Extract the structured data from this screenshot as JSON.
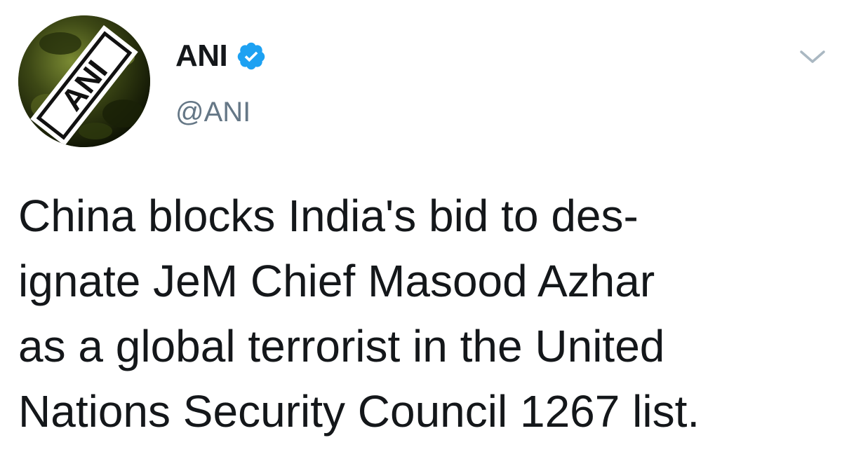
{
  "tweet": {
    "author": {
      "display_name": "ANI",
      "handle": "@ANI",
      "verified": true,
      "avatar_text": "ANI"
    },
    "text_lines": [
      "China blocks India's bid to des-",
      "ignate JeM Chief Masood Azhar",
      "as a global terrorist in the United",
      "Nations Security Council 1267 list."
    ],
    "colors": {
      "verified_badge": "#1da1f2",
      "handle": "#657786",
      "text": "#14171a",
      "chevron": "#aab8c2"
    },
    "icons": {
      "verified": "verified-badge-icon",
      "menu": "chevron-down-icon"
    }
  }
}
